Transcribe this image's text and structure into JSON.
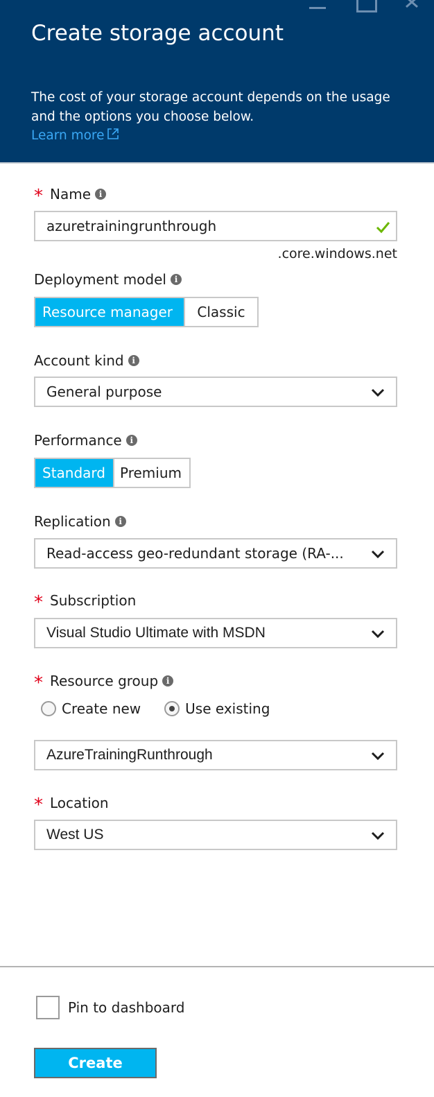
{
  "header": {
    "title": "Create storage account",
    "description": "The cost of your storage account depends on the usage and the options you choose below.",
    "learn_more": "Learn more"
  },
  "form": {
    "name": {
      "label": "Name",
      "required": true,
      "value": "azuretrainingrunthrough",
      "suffix": ".core.windows.net",
      "valid": true
    },
    "deployment_model": {
      "label": "Deployment model",
      "options": [
        "Resource manager",
        "Classic"
      ],
      "selected": "Resource manager"
    },
    "account_kind": {
      "label": "Account kind",
      "value": "General purpose"
    },
    "performance": {
      "label": "Performance",
      "options": [
        "Standard",
        "Premium"
      ],
      "selected": "Standard"
    },
    "replication": {
      "label": "Replication",
      "value": "Read-access geo-redundant storage (RA-..."
    },
    "subscription": {
      "label": "Subscription",
      "required": true,
      "value": "Visual Studio Ultimate with MSDN"
    },
    "resource_group": {
      "label": "Resource group",
      "required": true,
      "options": [
        "Create new",
        "Use existing"
      ],
      "selected": "Use existing",
      "value": "AzureTrainingRunthrough"
    },
    "location": {
      "label": "Location",
      "required": true,
      "value": "West US"
    }
  },
  "footer": {
    "pin_label": "Pin to dashboard",
    "pin_checked": false,
    "create_label": "Create"
  },
  "colors": {
    "header_bg": "#003a6b",
    "accent": "#00b5f0",
    "link": "#3aa8f5",
    "required": "#e0001a",
    "valid": "#6bb700"
  }
}
